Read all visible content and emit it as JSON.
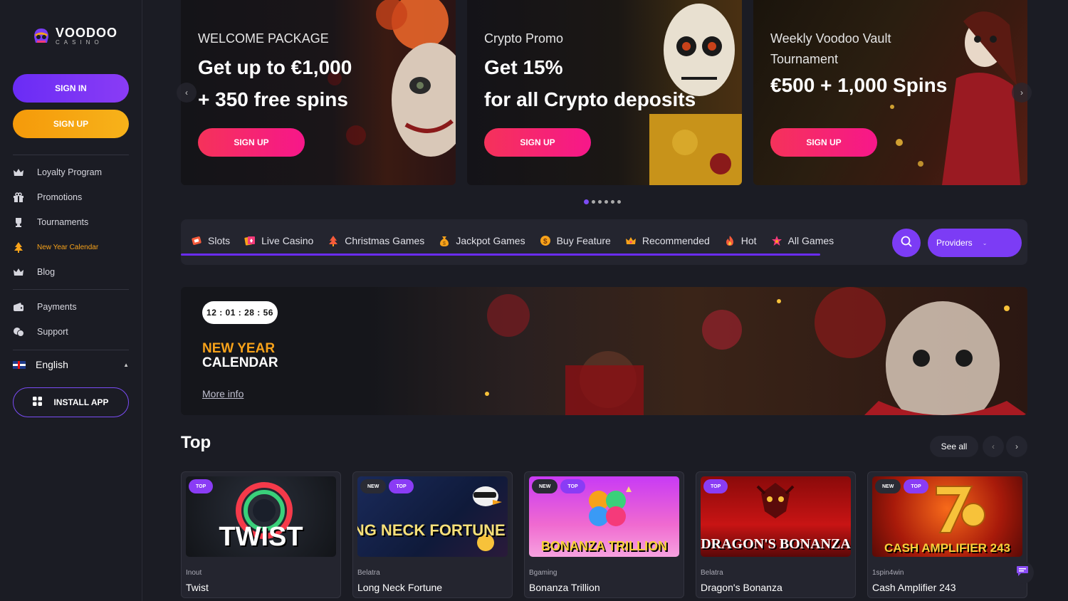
{
  "brand": {
    "name": "VOODOO",
    "tagline": "CASINO"
  },
  "sidebar": {
    "sign_in": "SIGN IN",
    "sign_up": "SIGN UP",
    "items": [
      {
        "label": "Loyalty Program",
        "icon": "crown-icon"
      },
      {
        "label": "Promotions",
        "icon": "gift-icon"
      },
      {
        "label": "Tournaments",
        "icon": "trophy-icon"
      },
      {
        "label": "New Year Calendar",
        "icon": "tree-icon",
        "active": true
      },
      {
        "label": "Blog",
        "icon": "blog-icon"
      },
      {
        "label": "Payments",
        "icon": "wallet-icon"
      },
      {
        "label": "Support",
        "icon": "support-icon"
      }
    ],
    "language": "English",
    "install_app": "INSTALL APP"
  },
  "promos": [
    {
      "subtitle": "WELCOME PACKAGE",
      "headline_1": "Get up to €1,000",
      "headline_2": "+ 350 free spins",
      "cta": "SIGN UP"
    },
    {
      "subtitle": "Crypto Promo",
      "headline_1": "Get 15%",
      "headline_2": "for all Crypto deposits",
      "cta": "SIGN UP"
    },
    {
      "subtitle_1": "Weekly Voodoo Vault",
      "subtitle_2": "Tournament",
      "headline_1": "€500 + 1,000 Spins",
      "cta": "SIGN UP"
    }
  ],
  "slider_dots": {
    "count": 6,
    "active": 0
  },
  "categories": [
    {
      "label": "Slots",
      "icon": "slots-icon"
    },
    {
      "label": "Live Casino",
      "icon": "live-casino-icon"
    },
    {
      "label": "Christmas Games",
      "icon": "christmas-tree-icon"
    },
    {
      "label": "Jackpot Games",
      "icon": "money-bag-icon"
    },
    {
      "label": "Buy Feature",
      "icon": "coin-icon"
    },
    {
      "label": "Recommended",
      "icon": "crown-icon"
    },
    {
      "label": "Hot",
      "icon": "fire-icon"
    },
    {
      "label": "All Games",
      "icon": "star-icon"
    }
  ],
  "providers_label": "Providers",
  "calendar": {
    "timer": "12 : 01 : 28 : 56",
    "title_1": "NEW YEAR",
    "title_2": "CALENDAR",
    "more_info": "More info"
  },
  "top_section": {
    "title": "Top",
    "see_all": "See all",
    "games": [
      {
        "provider": "Inout",
        "title": "Twist",
        "art_text": "TWIST",
        "badges": [
          "TOP"
        ]
      },
      {
        "provider": "Belatra",
        "title": "Long Neck Fortune",
        "art_text": "LONG NECK FORTUNE",
        "badges": [
          "NEW",
          "TOP"
        ]
      },
      {
        "provider": "Bgaming",
        "title": "Bonanza Trillion",
        "art_text": "BONANZA TRILLION",
        "badges": [
          "NEW",
          "TOP"
        ]
      },
      {
        "provider": "Belatra",
        "title": "Dragon's Bonanza",
        "art_text": "DRAGON'S BONANZA",
        "badges": [
          "TOP"
        ]
      },
      {
        "provider": "1spin4win",
        "title": "Cash Amplifier 243",
        "art_text": "CASH AMPLIFIER 243",
        "badges": [
          "NEW",
          "TOP"
        ]
      }
    ]
  }
}
